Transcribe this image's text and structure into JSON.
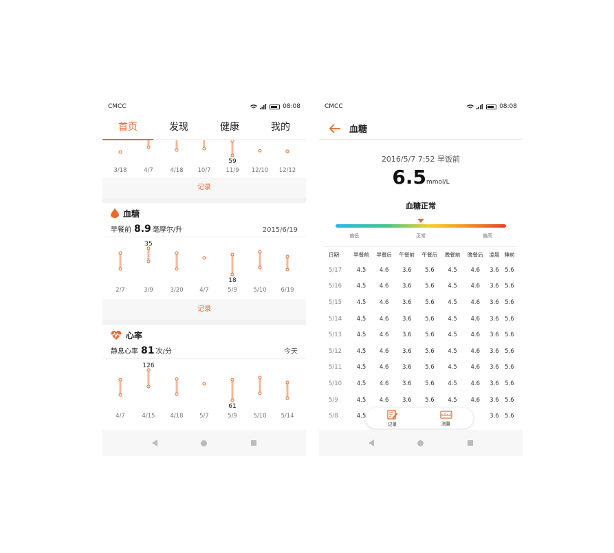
{
  "left": {
    "status": {
      "carrier": "CMCC",
      "time": "08:08"
    },
    "tabs": [
      {
        "label": "首页"
      },
      {
        "label": "发现"
      },
      {
        "label": "健康"
      },
      {
        "label": "我的"
      }
    ],
    "top_chart": {
      "dates": [
        "3/18",
        "4/7",
        "4/18",
        "10/7",
        "11/9",
        "12/10",
        "12/12"
      ],
      "min_label": "59"
    },
    "record_label": "记录",
    "glucose": {
      "title": "血糖",
      "sub_prefix": "早餐前",
      "value": "8.9",
      "unit": "毫摩尔/升",
      "date": "2015/6/19",
      "dates": [
        "2/7",
        "3/9",
        "3/20",
        "4/7",
        "5/9",
        "5/10",
        "6/19"
      ],
      "max_label": "35",
      "min_label": "18",
      "record_label": "记录"
    },
    "heart": {
      "title": "心率",
      "sub_prefix": "静息心率",
      "value": "81",
      "unit": "次/分",
      "date": "今天",
      "dates": [
        "4/7",
        "4/15",
        "4/18",
        "5/7",
        "5/9",
        "5/10",
        "5/14"
      ],
      "max_label": "126",
      "min_label": "61"
    }
  },
  "right": {
    "status": {
      "carrier": "CMCC",
      "time": "08:08"
    },
    "title": "血糖",
    "reading_time": "2016/5/7 7:52 早饭前",
    "reading_value": "6.5",
    "reading_unit": "mmol/L",
    "status_label": "血糖正常",
    "gauge_labels": [
      "偏低",
      "正常",
      "偏高"
    ],
    "gauge_level_percent": 50,
    "table": {
      "headers": [
        "日期",
        "早餐前",
        "早餐后",
        "午餐前",
        "午餐后",
        "晚餐前",
        "晚餐后",
        "凌晨",
        "睡前"
      ],
      "rows": [
        [
          "5/17",
          "4.5",
          "4.6",
          "3.6",
          "5.6",
          "4.5",
          "4.6",
          "3.6",
          "5.6"
        ],
        [
          "5/16",
          "4.5",
          "4.6",
          "3.6",
          "5.6",
          "4.5",
          "4.6",
          "3.6",
          "5.6"
        ],
        [
          "5/15",
          "4.5",
          "4.6",
          "3.6",
          "5.6",
          "4.5",
          "4.6",
          "3.6",
          "5.6"
        ],
        [
          "5/14",
          "4.5",
          "4.6",
          "3.6",
          "5.6",
          "4.5",
          "4.6",
          "3.6",
          "5.6"
        ],
        [
          "5/13",
          "4.5",
          "4.6",
          "3.6",
          "5.6",
          "4.5",
          "4.6",
          "3.6",
          "5.6"
        ],
        [
          "5/12",
          "4.5",
          "4.6",
          "3.6",
          "5.6",
          "4.5",
          "4.6",
          "3.6",
          "5.6"
        ],
        [
          "5/11",
          "4.5",
          "4.6",
          "3.6",
          "5.6",
          "4.5",
          "4.6",
          "3.6",
          "5.6"
        ],
        [
          "5/10",
          "4.5",
          "4.6",
          "3.6",
          "5.6",
          "4.5",
          "4.6",
          "3.6",
          "5.6"
        ],
        [
          "5/9",
          "4.5",
          "4.6",
          "3.6",
          "5.6",
          "4.5",
          "4.6",
          "3.6",
          "5.6"
        ],
        [
          "5/8",
          "4.5",
          "",
          "",
          "",
          "",
          "",
          "3.6",
          "5.6"
        ]
      ]
    },
    "float": {
      "record_label": "记录",
      "measure_label": "测量"
    }
  },
  "colors": {
    "accent": "#e8692b",
    "range_line": "#f5b59a"
  }
}
